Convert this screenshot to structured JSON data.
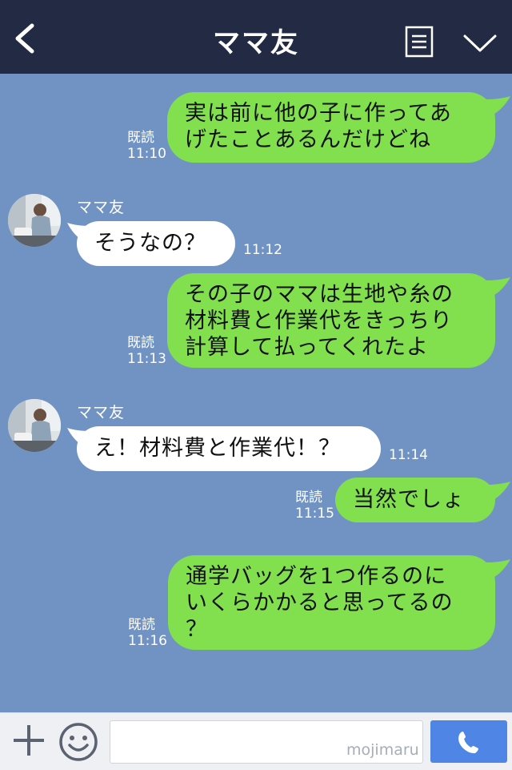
{
  "header": {
    "title": "ママ友"
  },
  "messages": [
    {
      "text": "実は前に他の子に作ってあ\nげたことあるんだけどね",
      "read": "既読",
      "time": "11:10"
    },
    {
      "sender": "ママ友",
      "text": "そうなの？",
      "time": "11:12"
    },
    {
      "text": "その子のママは生地や糸の\n材料費と作業代をきっちり\n計算して払ってくれたよ",
      "read": "既読",
      "time": "11:13"
    },
    {
      "sender": "ママ友",
      "text": "え！材料費と作業代！？",
      "time": "11:14"
    },
    {
      "text": "当然でしょ",
      "read": "既読",
      "time": "11:15"
    },
    {
      "text": "通学バッグを1つ作るのに\nいくらかかると思ってるの\n？",
      "read": "既読",
      "time": "11:16"
    }
  ],
  "input": {
    "value": ""
  },
  "watermark": "mojimaru",
  "colors": {
    "header": "#232b44",
    "chat_bg": "#7193c3",
    "outgoing": "#82e04f",
    "incoming": "#ffffff",
    "send": "#4f86e6"
  }
}
